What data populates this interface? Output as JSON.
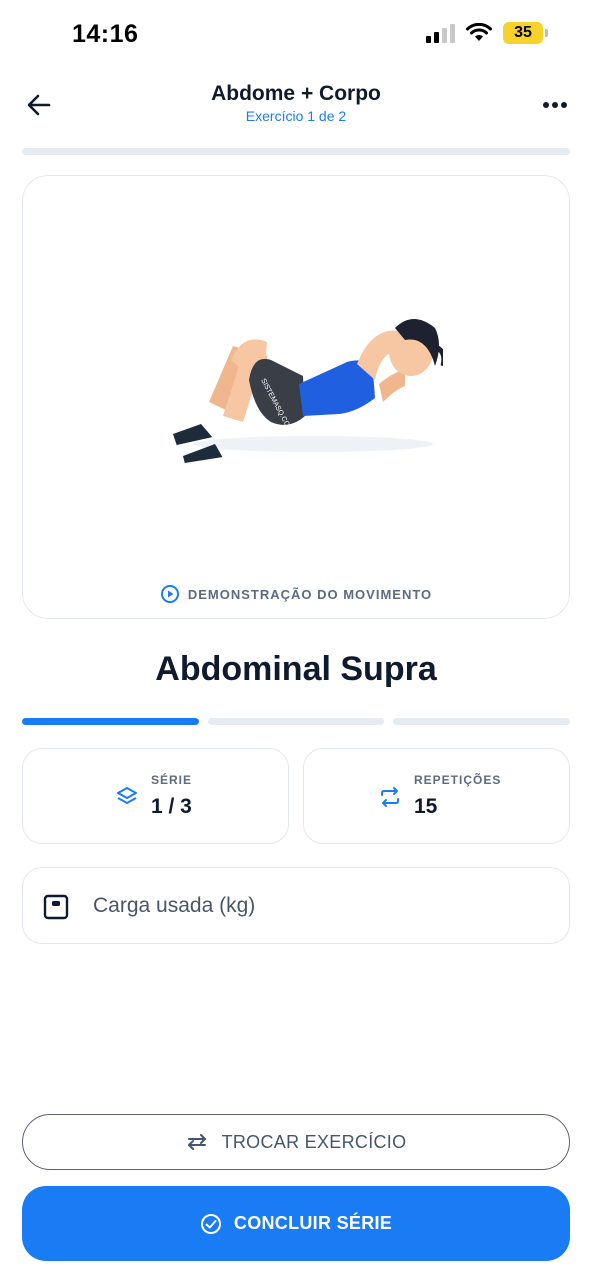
{
  "status_bar": {
    "time": "14:16",
    "battery_level": "35",
    "icons": [
      "signal-icon",
      "wifi-icon",
      "battery-icon"
    ]
  },
  "header": {
    "title": "Abdome + Corpo",
    "subtitle": "Exercício 1 de 2",
    "icons": [
      "back-arrow-icon",
      "more-options-icon"
    ]
  },
  "demo": {
    "caption": "DEMONSTRAÇÃO DO MOVIMENTO",
    "caption_icon": "play-circle-icon",
    "shirt_text": "SISTEMASQ.COM"
  },
  "exercise": {
    "name": "Abdominal Supra",
    "set_progress": {
      "completed": 1,
      "total": 3
    }
  },
  "series": {
    "label": "SÉRIE",
    "value": "1 / 3",
    "icon": "layers-icon"
  },
  "reps": {
    "label": "REPETIÇÕES",
    "value": "15",
    "icon": "repeat-icon"
  },
  "weight": {
    "placeholder": "Carga usada (kg)",
    "value": "",
    "icon": "scale-icon"
  },
  "actions": {
    "swap_label": "TROCAR EXERCÍCIO",
    "swap_icon": "swap-arrows-icon",
    "finish_label": "CONCLUIR SÉRIE",
    "finish_icon": "check-circle-icon"
  },
  "colors": {
    "accent": "#1a7cf5",
    "text_primary": "#0f1b2d",
    "text_muted": "#5b6b80",
    "border": "#e3e8ef",
    "battery": "#f6d22a"
  }
}
